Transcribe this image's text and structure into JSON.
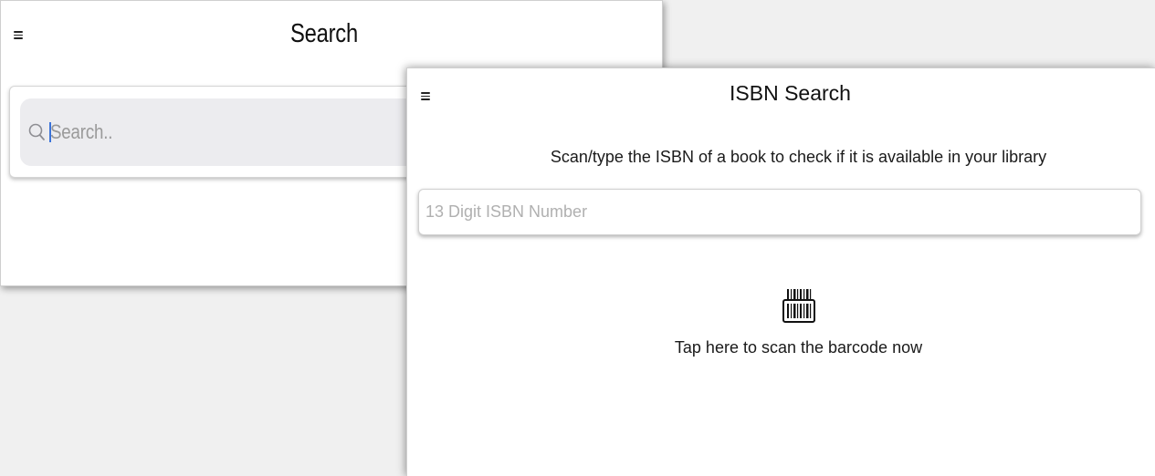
{
  "search_screen": {
    "title": "Search",
    "menu_icon": "hamburger-menu-icon",
    "search_icon": "magnifier-icon",
    "search_placeholder": "Search.."
  },
  "isbn_screen": {
    "title": "ISBN Search",
    "menu_icon": "hamburger-menu-icon",
    "instructions": "Scan/type the ISBN of a book to check if it is available in your library",
    "isbn_placeholder": "13 Digit ISBN Number",
    "barcode_icon": "barcode-scanner-icon",
    "scan_label": "Tap here to scan the barcode now"
  },
  "colors": {
    "background": "#f0f0f0",
    "screen": "#ffffff",
    "search_field": "#ececef",
    "caret": "#3b73d9",
    "placeholder": "#9a9a9a"
  }
}
